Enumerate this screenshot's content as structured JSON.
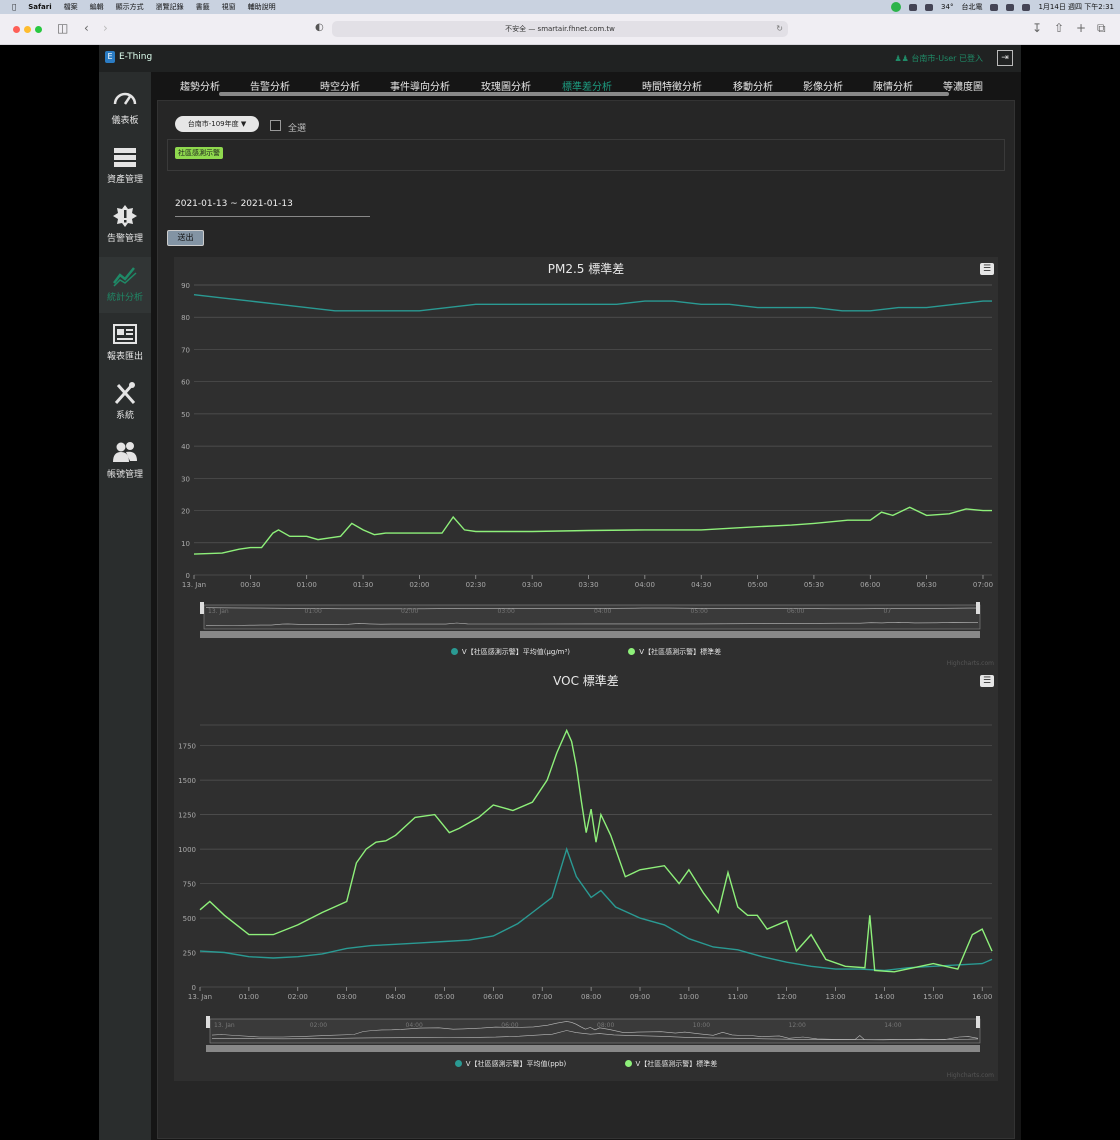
{
  "menubar": {
    "app": "Safari",
    "items": [
      "檔案",
      "編輯",
      "顯示方式",
      "瀏覽記錄",
      "書籤",
      "視窗",
      "輔助說明"
    ],
    "right": [
      "34°",
      "台北電",
      "1月14日 週四 下午2:31"
    ]
  },
  "browser": {
    "url": "不安全 — smartair.fhnet.com.tw"
  },
  "app": {
    "logo": "E-Thing",
    "user": "台南市-User 已登入",
    "sidebar": [
      {
        "label": "儀表板",
        "icon": "gauge-icon"
      },
      {
        "label": "資產管理",
        "icon": "server-icon"
      },
      {
        "label": "告警管理",
        "icon": "alert-icon"
      },
      {
        "label": "統計分析",
        "icon": "trend-icon",
        "active": true
      },
      {
        "label": "報表匯出",
        "icon": "report-icon"
      },
      {
        "label": "系統",
        "icon": "tools-icon"
      },
      {
        "label": "帳號管理",
        "icon": "users-icon"
      }
    ],
    "tabs": [
      "趨勢分析",
      "告警分析",
      "時空分析",
      "事件導向分析",
      "玫瑰圖分析",
      "標準差分析",
      "時間特徵分析",
      "移動分析",
      "影像分析",
      "陳情分析",
      "等濃度圖"
    ],
    "active_tab": "標準差分析"
  },
  "filters": {
    "select_value": "台南市-109年度 ▼",
    "select_all_label": "全選",
    "tag": "社區感測示警",
    "date_range": "2021-01-13 ~ 2021-01-13",
    "submit_label": "送出"
  },
  "colors": {
    "series_mean": "#2a9a93",
    "series_std": "#8ef07a",
    "accent": "#1d9b80"
  },
  "chart_data": [
    {
      "type": "line",
      "title": "PM2.5 標準差",
      "ylim": [
        0,
        90
      ],
      "yticks": [
        0,
        10,
        20,
        30,
        40,
        50,
        60,
        70,
        80,
        90
      ],
      "xlim": [
        0,
        7.08
      ],
      "xticks": [
        0,
        0.5,
        1,
        1.5,
        2,
        2.5,
        3,
        3.5,
        4,
        4.5,
        5,
        5.5,
        6,
        6.5,
        7
      ],
      "xtick_labels": [
        "13. Jan",
        "00:30",
        "01:00",
        "01:30",
        "02:00",
        "02:30",
        "03:00",
        "03:30",
        "04:00",
        "04:30",
        "05:00",
        "05:30",
        "06:00",
        "06:30",
        "07:00"
      ],
      "navigator_labels": [
        "13. Jan",
        "01:00",
        "02:00",
        "03:00",
        "04:00",
        "05:00",
        "06:00",
        "07"
      ],
      "x_unit": "hours",
      "series": [
        {
          "name": "V【社區感測示警】平均值(μg/m³)",
          "color": "#2a9a93",
          "x": [
            0,
            0.25,
            0.5,
            0.75,
            1,
            1.25,
            1.5,
            1.75,
            2,
            2.25,
            2.5,
            2.75,
            3,
            3.25,
            3.5,
            3.75,
            4,
            4.25,
            4.5,
            4.75,
            5,
            5.25,
            5.5,
            5.75,
            6,
            6.25,
            6.5,
            6.75,
            7,
            7.08
          ],
          "y": [
            87,
            86,
            85,
            84,
            83,
            82,
            82,
            82,
            82,
            83,
            84,
            84,
            84,
            84,
            84,
            84,
            85,
            85,
            84,
            84,
            83,
            83,
            83,
            82,
            82,
            83,
            83,
            84,
            85,
            85
          ]
        },
        {
          "name": "V【社區感測示警】標準差",
          "color": "#8ef07a",
          "x": [
            0,
            0.25,
            0.4,
            0.5,
            0.6,
            0.7,
            0.75,
            0.85,
            1,
            1.1,
            1.2,
            1.3,
            1.4,
            1.5,
            1.6,
            1.7,
            1.8,
            2,
            2.2,
            2.3,
            2.4,
            2.5,
            2.6,
            3,
            3.5,
            4,
            4.5,
            5,
            5.3,
            5.5,
            5.8,
            6,
            6.1,
            6.2,
            6.35,
            6.5,
            6.7,
            6.85,
            7,
            7.08
          ],
          "y": [
            6.5,
            6.8,
            8,
            8.5,
            8.5,
            13,
            14,
            12,
            12,
            11,
            11.5,
            12,
            16,
            14,
            12.5,
            13,
            13,
            13,
            13,
            18,
            14,
            13.5,
            13.5,
            13.5,
            13.8,
            14,
            14,
            15,
            15.5,
            16,
            17,
            17,
            19.5,
            18.5,
            21,
            18.5,
            19,
            20.5,
            20,
            20
          ]
        }
      ]
    },
    {
      "type": "line",
      "title": "VOC 標準差",
      "ylim": [
        0,
        1900
      ],
      "yticks": [
        0,
        250,
        500,
        750,
        1000,
        1250,
        1500,
        1750
      ],
      "xlim": [
        0,
        16.2
      ],
      "xticks": [
        0,
        1,
        2,
        3,
        4,
        5,
        6,
        7,
        8,
        9,
        10,
        11,
        12,
        13,
        14,
        15,
        16
      ],
      "xtick_labels": [
        "13. Jan",
        "01:00",
        "02:00",
        "03:00",
        "04:00",
        "05:00",
        "06:00",
        "07:00",
        "08:00",
        "09:00",
        "10:00",
        "11:00",
        "12:00",
        "13:00",
        "14:00",
        "15:00",
        "16:00"
      ],
      "navigator_labels": [
        "13. Jan",
        "02:00",
        "04:00",
        "06:00",
        "08:00",
        "10:00",
        "12:00",
        "14:00"
      ],
      "x_unit": "hours",
      "series": [
        {
          "name": "V【社區感測示警】平均值(ppb)",
          "color": "#2a9a93",
          "x": [
            0,
            0.5,
            1,
            1.5,
            2,
            2.5,
            3,
            3.5,
            4,
            4.5,
            5,
            5.5,
            6,
            6.5,
            6.8,
            7.2,
            7.5,
            7.7,
            8,
            8.2,
            8.5,
            9,
            9.5,
            10,
            10.5,
            11,
            11.5,
            12,
            12.5,
            13,
            13.5,
            14,
            14.5,
            15,
            15.5,
            16,
            16.2
          ],
          "y": [
            260,
            250,
            220,
            210,
            220,
            240,
            280,
            300,
            310,
            320,
            330,
            340,
            370,
            460,
            540,
            650,
            1000,
            800,
            650,
            700,
            580,
            500,
            450,
            350,
            290,
            270,
            220,
            180,
            150,
            130,
            130,
            120,
            140,
            150,
            160,
            170,
            200
          ]
        },
        {
          "name": "V【社區感測示警】標準差",
          "color": "#8ef07a",
          "x": [
            0,
            0.2,
            0.5,
            1,
            1.5,
            2,
            2.5,
            3,
            3.2,
            3.4,
            3.6,
            3.8,
            4,
            4.4,
            4.8,
            5.1,
            5.3,
            5.7,
            6,
            6.4,
            6.8,
            7.1,
            7.3,
            7.5,
            7.6,
            7.7,
            7.8,
            7.9,
            8.0,
            8.1,
            8.2,
            8.4,
            8.7,
            9,
            9.5,
            9.8,
            10,
            10.3,
            10.6,
            10.8,
            11,
            11.2,
            11.4,
            11.6,
            12,
            12.2,
            12.5,
            12.8,
            13.2,
            13.6,
            13.7,
            13.8,
            14.2,
            14.6,
            15,
            15.5,
            15.8,
            16,
            16.2
          ],
          "y": [
            560,
            620,
            520,
            380,
            380,
            450,
            540,
            620,
            900,
            1000,
            1050,
            1060,
            1100,
            1230,
            1250,
            1120,
            1150,
            1230,
            1320,
            1280,
            1340,
            1500,
            1700,
            1860,
            1780,
            1600,
            1350,
            1120,
            1290,
            1050,
            1250,
            1100,
            800,
            850,
            880,
            750,
            850,
            680,
            540,
            830,
            580,
            520,
            520,
            420,
            480,
            260,
            380,
            200,
            150,
            140,
            520,
            120,
            110,
            140,
            170,
            130,
            380,
            420,
            260
          ]
        }
      ]
    }
  ],
  "credits": "Highcharts.com"
}
